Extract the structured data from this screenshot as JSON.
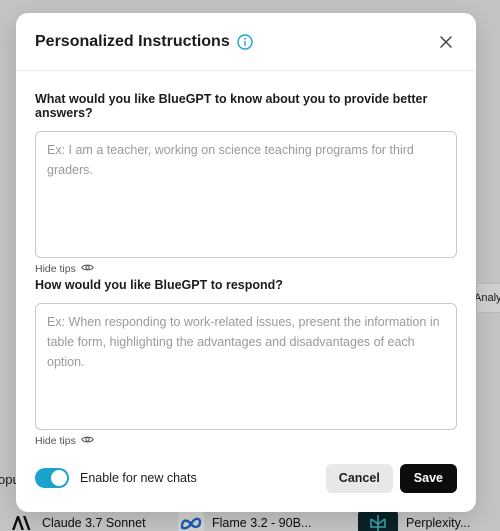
{
  "background": {
    "fragment_left": "opu",
    "fragment_right": "Analy",
    "models": [
      {
        "name": "Claude 3.7 Sonnet",
        "icon": "anthropic-icon"
      },
      {
        "name": "Flame 3.2 - 90B...",
        "icon": "meta-icon"
      },
      {
        "name": "Perplexity...",
        "icon": "perplexity-icon"
      }
    ]
  },
  "modal": {
    "title": "Personalized Instructions",
    "info_icon": "info-icon",
    "close_icon": "close-icon",
    "question1": {
      "label": "What would you like BlueGPT to know about you to provide better answers?",
      "value": "",
      "placeholder": "Ex: I am a teacher, working on science teaching programs for third graders."
    },
    "hide_tips_1": "Hide tips",
    "question2": {
      "label": "How would you like BlueGPT to respond?",
      "value": "",
      "placeholder": "Ex: When responding to work-related issues, present the information in table form, highlighting the advantages and disadvantages of each option."
    },
    "hide_tips_2": "Hide tips",
    "footer": {
      "toggle_label": "Enable for new chats",
      "toggle_on": true,
      "cancel_label": "Cancel",
      "save_label": "Save"
    }
  },
  "colors": {
    "accent": "#1aa4cc",
    "save_button": "#0c0c0c",
    "cancel_button": "#e8e8e8"
  }
}
